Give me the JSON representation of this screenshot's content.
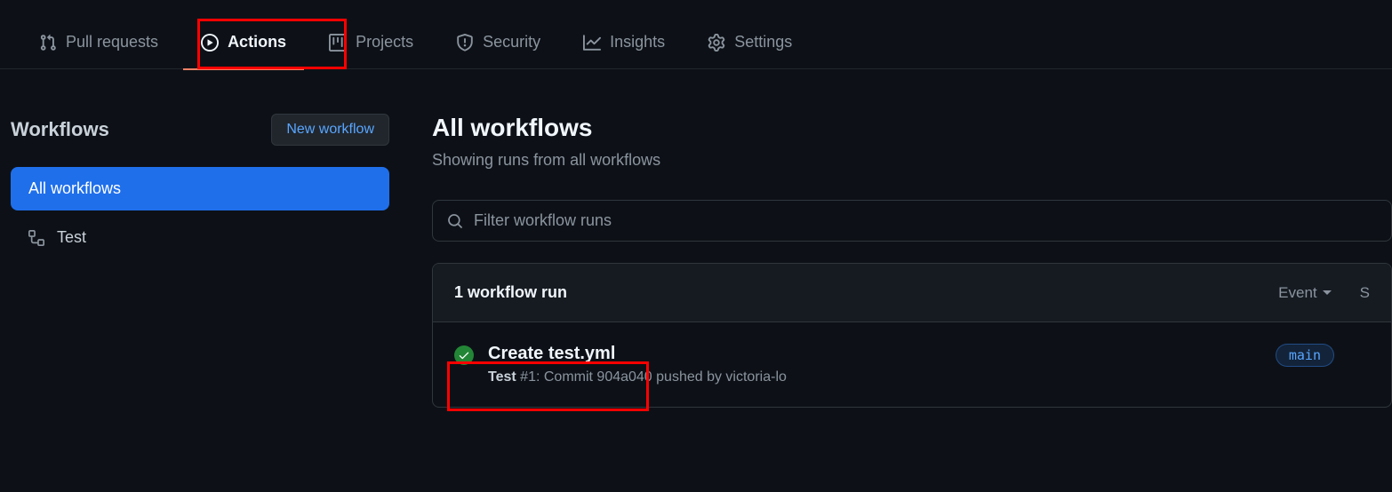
{
  "nav": {
    "pull_requests": "Pull requests",
    "actions": "Actions",
    "projects": "Projects",
    "security": "Security",
    "insights": "Insights",
    "settings": "Settings"
  },
  "sidebar": {
    "title": "Workflows",
    "new_button": "New workflow",
    "all_workflows": "All workflows",
    "items": [
      {
        "label": "Test"
      }
    ]
  },
  "main": {
    "title": "All workflows",
    "subtitle": "Showing runs from all workflows",
    "filter_placeholder": "Filter workflow runs",
    "runs_count": "1 workflow run",
    "filters": {
      "event": "Event",
      "status_initial": "S"
    },
    "run": {
      "title": "Create test.yml",
      "workflow_name": "Test",
      "run_number": "#1",
      "meta_rest": ": Commit 904a040 pushed by victoria-lo",
      "branch": "main"
    }
  }
}
